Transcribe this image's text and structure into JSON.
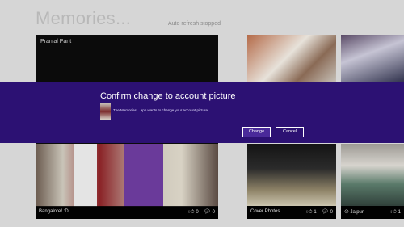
{
  "app": {
    "title": "Memories...",
    "refresh_status": "Auto refresh stopped"
  },
  "tiles": {
    "main": {
      "owner": "Pranjal Pant",
      "caption": "Bangalore! :D",
      "likes": "0",
      "comments": "0"
    },
    "cover": {
      "caption": "Cover Photos",
      "likes": "1",
      "comments": "0"
    },
    "jaipur": {
      "caption": "Jaipur",
      "likes": "1"
    }
  },
  "dialog": {
    "title": "Confirm change to account picture",
    "message": "The Memories... app wants to change your account picture.",
    "change_label": "Change",
    "cancel_label": "Cancel"
  },
  "colors": {
    "dialog_bg": "#2c1173",
    "page_bg": "#d6d6d6",
    "tile_bg": "#0b0b0b"
  },
  "icons": {
    "like": "thumbs-up-icon",
    "comment": "comment-icon",
    "location": "location-pin-icon"
  }
}
